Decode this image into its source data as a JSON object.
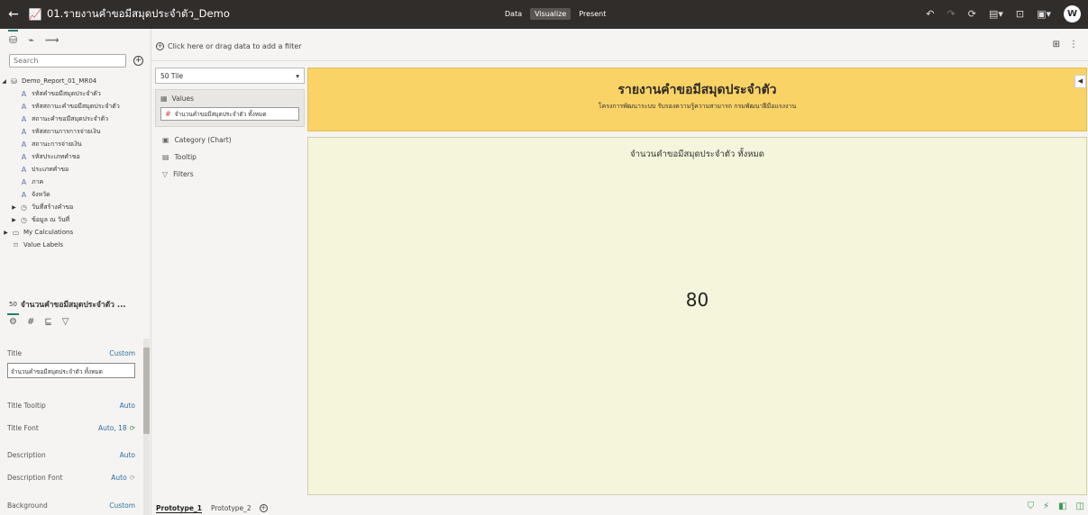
{
  "topbar": {
    "back_icon": "arrow-left-icon",
    "project_title": "01.รายงานคำขอมีสมุดประจำตัว_Demo",
    "modes": [
      "Data",
      "Visualize",
      "Present"
    ],
    "active_mode": "Visualize",
    "user_initial": "W"
  },
  "data_panel": {
    "search_placeholder": "Search",
    "dataset_name": "Demo_Report_01_MR04",
    "columns": [
      "รหัสคำขอมีสมุดประจำตัว",
      "รหัสสถานะคำขอมีสมุดประจำตัว",
      "สถานะคำขอมีสมุดประจำตัว",
      "รหัสสถานการการจ่ายเงิน",
      "สถานะการจ่ายเงิน",
      "รหัสประเภทคำขอ",
      "ประเภทคำขอ",
      "ภาค",
      "จังหวัด"
    ],
    "date_columns": [
      "วันที่สร้างคำขอ",
      "ข้อมูล ณ วันที่"
    ],
    "my_calculations": "My Calculations",
    "value_labels": "Value Labels"
  },
  "properties": {
    "header_title": "จำนวนคำขอมีสมุดประจำตัว ...",
    "tile_glyph": "50",
    "rows": {
      "title_label": "Title",
      "title_value": "Custom",
      "title_input_value": "จำนวนคำขอมีสมุดประจำตัว ทั้งหมด",
      "title_tooltip_label": "Title Tooltip",
      "title_tooltip_value": "Auto",
      "title_font_label": "Title Font",
      "title_font_value": "Auto, 18",
      "description_label": "Description",
      "description_value": "Auto",
      "description_font_label": "Description Font",
      "description_font_value": "Auto",
      "background_label": "Background",
      "background_value": "Custom"
    }
  },
  "filterbar": {
    "placeholder": "Click here or drag data to add a filter"
  },
  "grammar": {
    "viz_type": "50 Tile",
    "values_label": "Values",
    "value_pill": "จำนวนคำขอมีสมุดประจำตัว ทั้งหมด",
    "category_label": "Category (Chart)",
    "tooltip_label": "Tooltip",
    "filters_label": "Filters"
  },
  "canvas": {
    "header_title": "รายงานคำขอมีสมุดประจำตัว",
    "header_subtitle": "โครงการพัฒนาระบบ รับรองความรู้ความสามารถ กรมพัฒนาฝีมือแรงงาน",
    "tile_title": "จำนวนคำขอมีสมุดประจำตัว ทั้งหมด",
    "tile_value": "80",
    "header_bg": "#f9d366",
    "tile_bg": "#f5f5dc"
  },
  "bottombar": {
    "canvas_tabs": [
      "Prototype_1",
      "Prototype_2"
    ],
    "active_tab": "Prototype_1"
  }
}
